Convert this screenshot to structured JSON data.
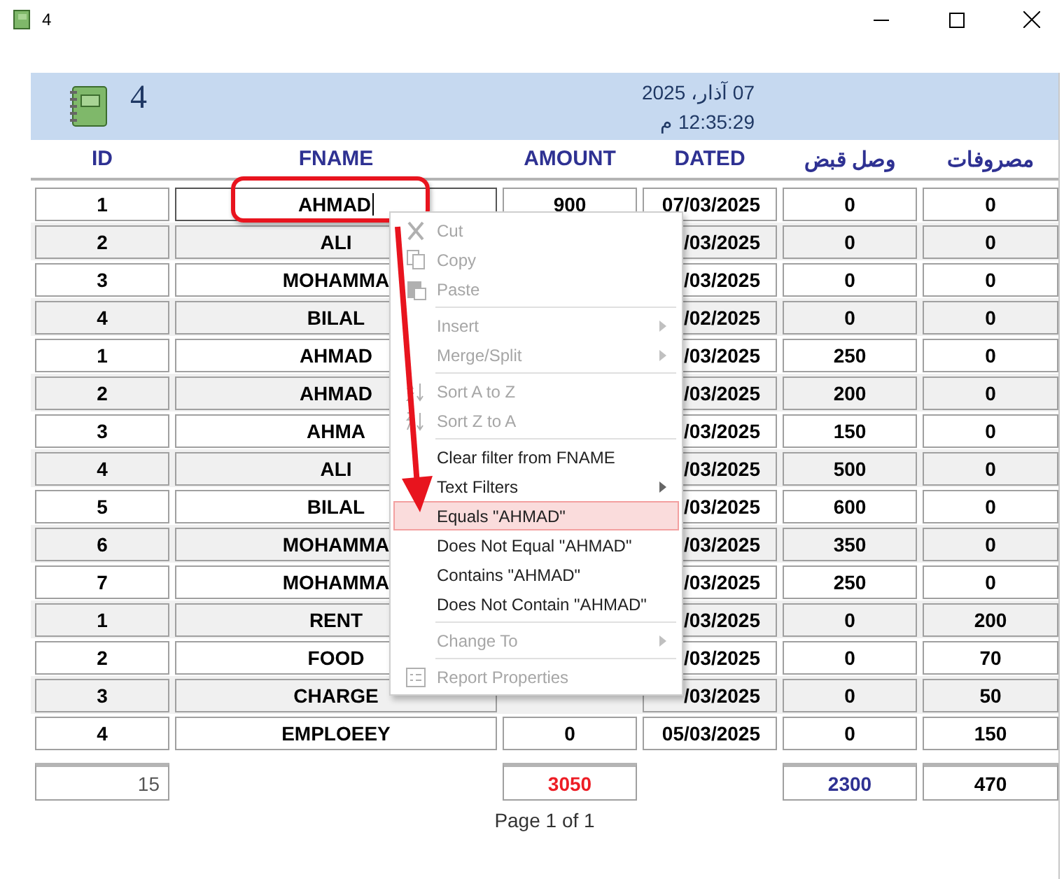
{
  "window": {
    "title": "4"
  },
  "report_header": {
    "title": "4",
    "date": "07 آذار، 2025",
    "time": "12:35:29 م"
  },
  "columns": [
    "ID",
    "FNAME",
    "AMOUNT",
    "DATED",
    "وصل قبض",
    "مصروفات"
  ],
  "rows": [
    {
      "id": "1",
      "fname": "AHMAD",
      "amount": "900",
      "dated": "07/03/2025",
      "receipt": "0",
      "expense": "0",
      "focused": true
    },
    {
      "id": "2",
      "fname": "ALI",
      "dated": "/03/2025",
      "receipt": "0",
      "expense": "0",
      "focused": false
    },
    {
      "id": "3",
      "fname": "MOHAMMA",
      "dated": "/03/2025",
      "receipt": "0",
      "expense": "0",
      "focused": false
    },
    {
      "id": "4",
      "fname": "BILAL",
      "dated": "/02/2025",
      "receipt": "0",
      "expense": "0",
      "focused": false
    },
    {
      "id": "1",
      "fname": "AHMAD",
      "dated": "/03/2025",
      "receipt": "250",
      "expense": "0",
      "focused": false
    },
    {
      "id": "2",
      "fname": "AHMAD",
      "dated": "/03/2025",
      "receipt": "200",
      "expense": "0",
      "focused": false
    },
    {
      "id": "3",
      "fname": "AHMA",
      "dated": "/03/2025",
      "receipt": "150",
      "expense": "0",
      "focused": false
    },
    {
      "id": "4",
      "fname": "ALI",
      "dated": "/03/2025",
      "receipt": "500",
      "expense": "0",
      "focused": false
    },
    {
      "id": "5",
      "fname": "BILAL",
      "dated": "/03/2025",
      "receipt": "600",
      "expense": "0",
      "focused": false
    },
    {
      "id": "6",
      "fname": "MOHAMMA",
      "dated": "/03/2025",
      "receipt": "350",
      "expense": "0",
      "focused": false
    },
    {
      "id": "7",
      "fname": "MOHAMMA",
      "dated": "/03/2025",
      "receipt": "250",
      "expense": "0",
      "focused": false
    },
    {
      "id": "1",
      "fname": "RENT",
      "dated": "/03/2025",
      "receipt": "0",
      "expense": "200",
      "focused": false
    },
    {
      "id": "2",
      "fname": "FOOD",
      "dated": "/03/2025",
      "receipt": "0",
      "expense": "70",
      "focused": false
    },
    {
      "id": "3",
      "fname": "CHARGE",
      "dated": "/03/2025",
      "receipt": "0",
      "expense": "50",
      "focused": false
    },
    {
      "id": "4",
      "fname": "EMPLOEEY",
      "amount": "0",
      "dated": "05/03/2025",
      "receipt": "0",
      "expense": "150",
      "focused": false
    }
  ],
  "totals": {
    "id": "15",
    "amount": "3050",
    "receipt": "2300",
    "expense": "470"
  },
  "page_footer": "Page 1 of 1",
  "context_menu": {
    "items": [
      {
        "kind": "item",
        "label": "Cut",
        "disabled": true,
        "submenu": false,
        "selected": false
      },
      {
        "kind": "item",
        "label": "Copy",
        "disabled": true,
        "submenu": false,
        "selected": false
      },
      {
        "kind": "item",
        "label": "Paste",
        "disabled": true,
        "submenu": false,
        "selected": false
      },
      {
        "kind": "separator"
      },
      {
        "kind": "item",
        "label": "Insert",
        "disabled": true,
        "submenu": true,
        "selected": false
      },
      {
        "kind": "item",
        "label": "Merge/Split",
        "disabled": true,
        "submenu": true,
        "selected": false
      },
      {
        "kind": "separator"
      },
      {
        "kind": "item",
        "label": "Sort A to Z",
        "disabled": true,
        "submenu": false,
        "selected": false
      },
      {
        "kind": "item",
        "label": "Sort Z to A",
        "disabled": true,
        "submenu": false,
        "selected": false
      },
      {
        "kind": "separator"
      },
      {
        "kind": "item",
        "label": "Clear filter from FNAME",
        "disabled": false,
        "submenu": false,
        "selected": false
      },
      {
        "kind": "item",
        "label": "Text Filters",
        "disabled": false,
        "submenu": true,
        "selected": false
      },
      {
        "kind": "item",
        "label": "Equals \"AHMAD\"",
        "disabled": false,
        "submenu": false,
        "selected": true
      },
      {
        "kind": "item",
        "label": "Does Not Equal \"AHMAD\"",
        "disabled": false,
        "submenu": false,
        "selected": false
      },
      {
        "kind": "item",
        "label": "Contains \"AHMAD\"",
        "disabled": false,
        "submenu": false,
        "selected": false
      },
      {
        "kind": "item",
        "label": "Does Not Contain \"AHMAD\"",
        "disabled": false,
        "submenu": false,
        "selected": false
      },
      {
        "kind": "separator"
      },
      {
        "kind": "item",
        "label": "Change To",
        "disabled": true,
        "submenu": true,
        "selected": false
      },
      {
        "kind": "separator"
      },
      {
        "kind": "item",
        "label": "Report Properties",
        "disabled": true,
        "submenu": false,
        "selected": false
      }
    ]
  }
}
